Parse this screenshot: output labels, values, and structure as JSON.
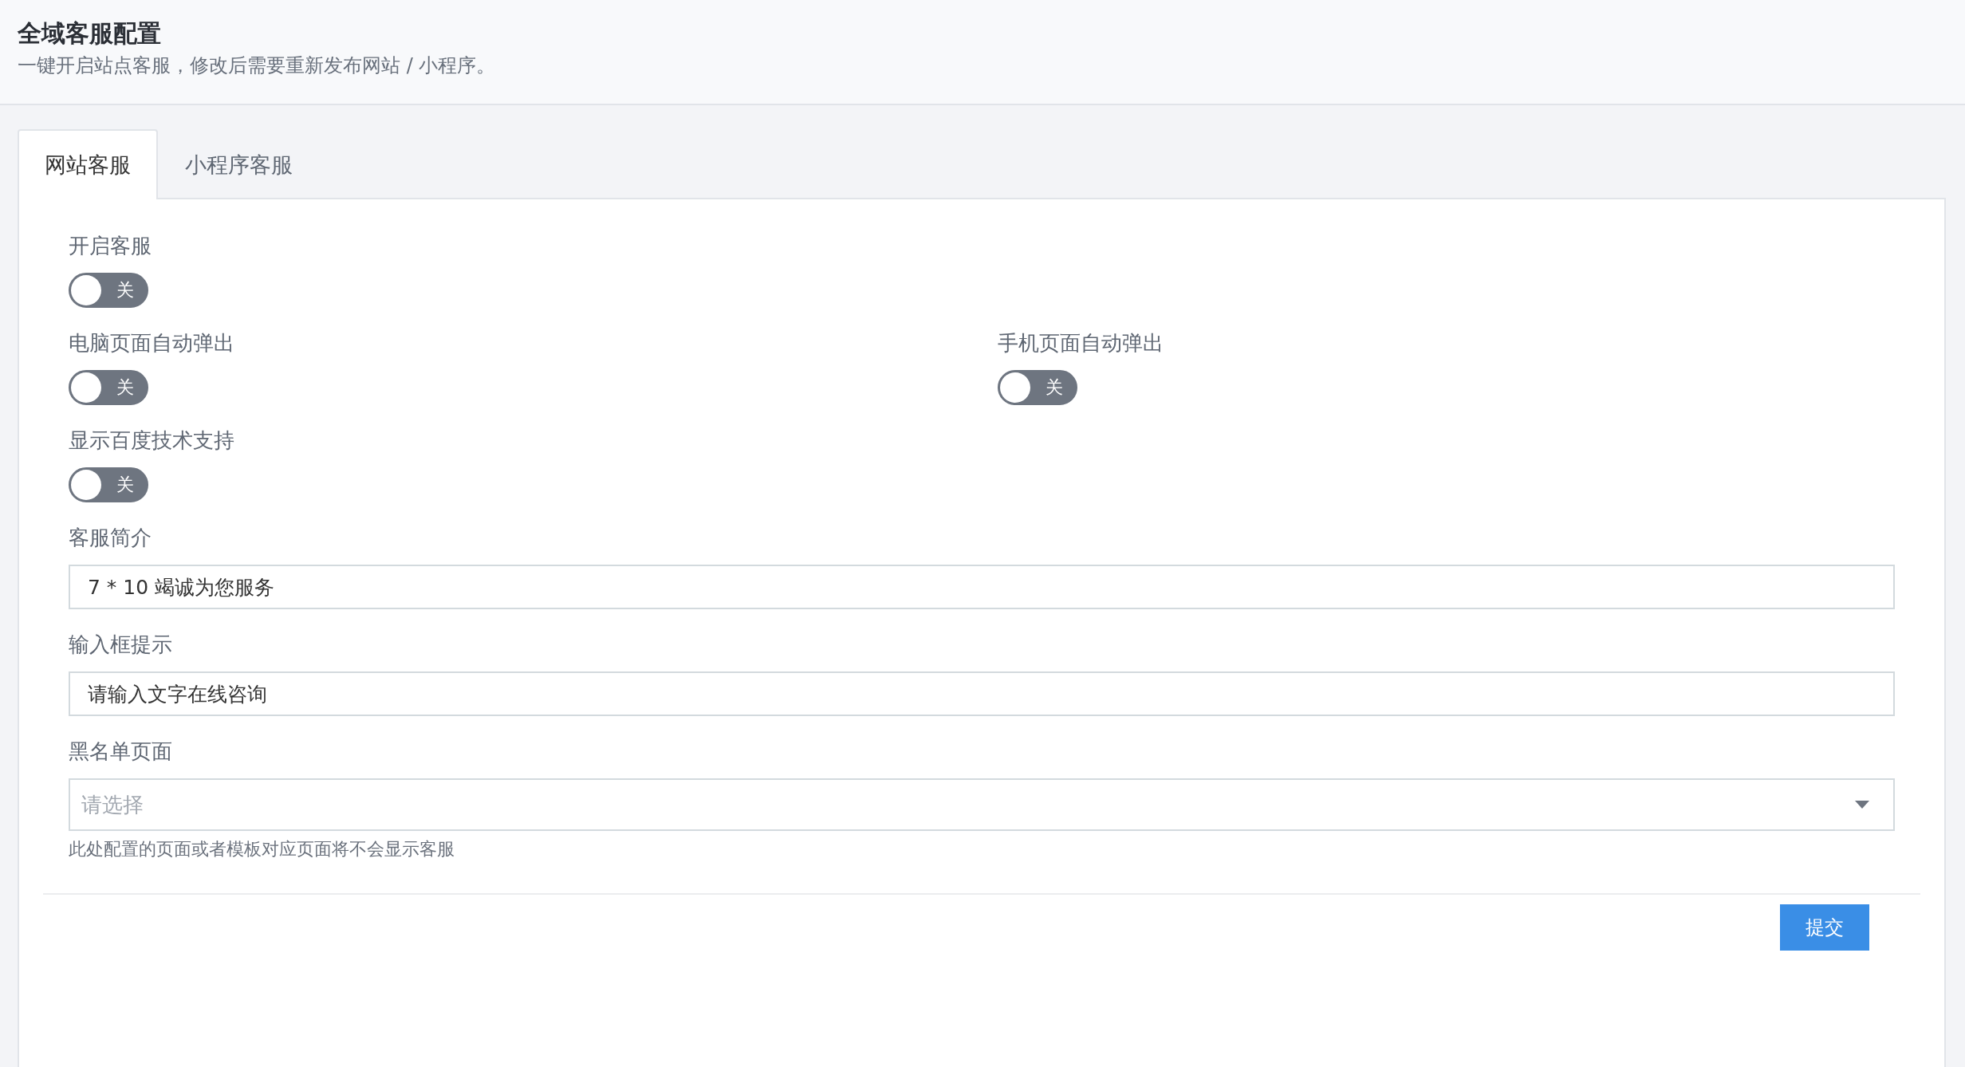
{
  "header": {
    "title": "全域客服配置",
    "subtitle": "一键开启站点客服，修改后需要重新发布网站 / 小程序。"
  },
  "tabs": [
    {
      "label": "网站客服",
      "selected": true
    },
    {
      "label": "小程序客服",
      "selected": false
    }
  ],
  "rows": [
    [
      {
        "kind": "toggle",
        "label": "开启客服",
        "on": false,
        "text": "关"
      }
    ],
    [
      {
        "kind": "toggle",
        "label": "电脑页面自动弹出",
        "on": false,
        "text": "关"
      },
      {
        "kind": "toggle",
        "label": "手机页面自动弹出",
        "on": false,
        "text": "关"
      }
    ],
    [
      {
        "kind": "toggle",
        "label": "显示百度技术支持",
        "on": false,
        "text": "关"
      }
    ],
    [
      {
        "kind": "text",
        "label": "客服简介",
        "value": "7 * 10 竭诚为您服务"
      }
    ],
    [
      {
        "kind": "text",
        "label": "输入框提示",
        "value": "请输入文字在线咨询"
      }
    ],
    [
      {
        "kind": "select",
        "label": "黑名单页面",
        "placeholder": "请选择",
        "help": "此处配置的页面或者模板对应页面将不会显示客服"
      }
    ]
  ],
  "submit": "提交"
}
